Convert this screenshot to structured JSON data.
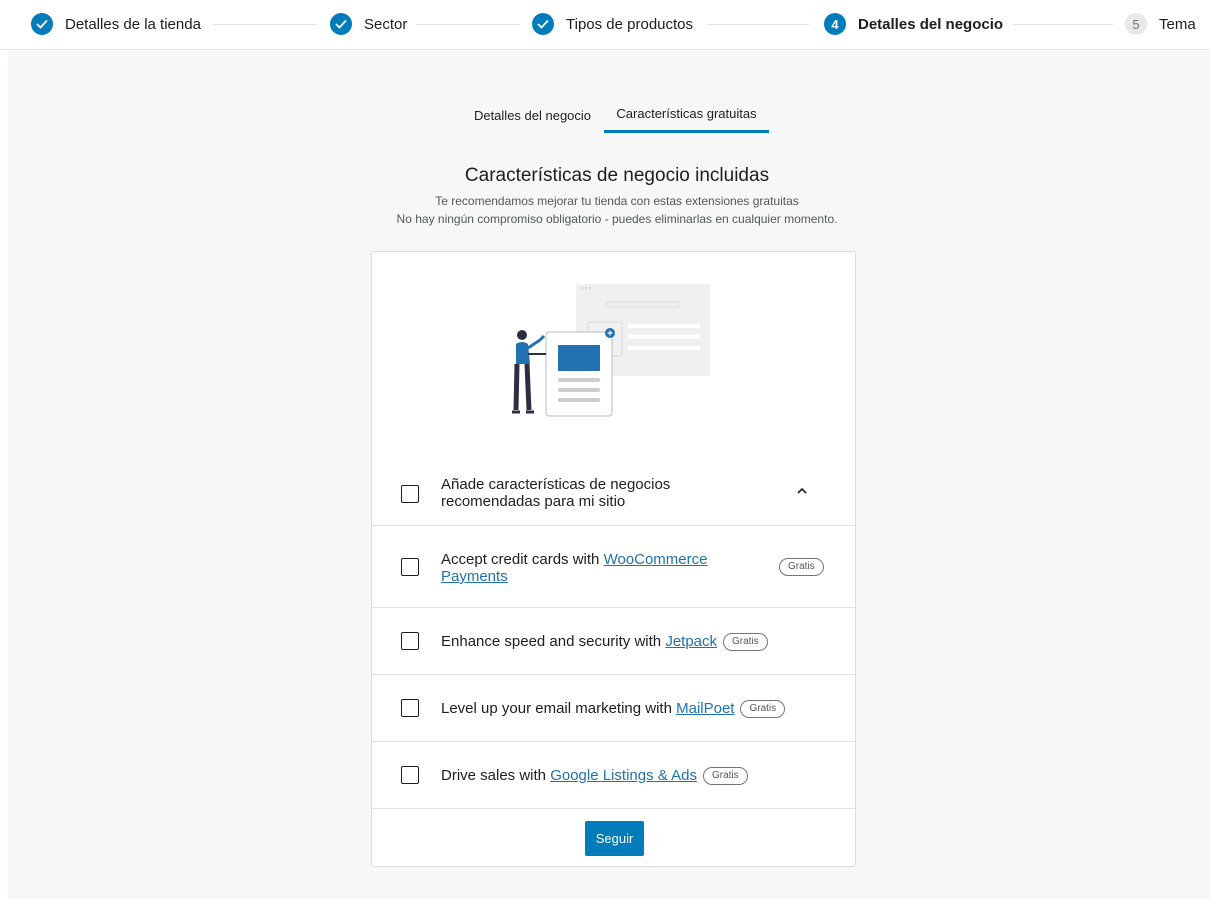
{
  "stepper": {
    "steps": [
      {
        "label": "Detalles de la tienda",
        "status": "done"
      },
      {
        "label": "Sector",
        "status": "done"
      },
      {
        "label": "Tipos de productos",
        "status": "done"
      },
      {
        "label": "Detalles del negocio",
        "status": "active",
        "number": "4"
      },
      {
        "label": "Tema",
        "status": "pending",
        "number": "5"
      }
    ]
  },
  "tabs": [
    {
      "label": "Detalles del negocio",
      "active": false
    },
    {
      "label": "Características gratuitas",
      "active": true
    }
  ],
  "heading": "Características de negocio incluidas",
  "subtitle_1": "Te recomendamos mejorar tu tienda con estas extensiones gratuitas",
  "subtitle_2": "No hay ningún compromiso obligatorio - puedes eliminarlas en cualquier momento.",
  "card": {
    "master": {
      "line1": "Añade características de negocios",
      "line2": "recomendadas para mi sitio",
      "checked": false,
      "expanded": true
    },
    "items": [
      {
        "prefix": "Accept credit cards with ",
        "link": "WooCommerce Payments",
        "link_line1": "WooCommerce",
        "link_line2": "Payments",
        "badge": "Gratis",
        "checked": false
      },
      {
        "prefix": "Enhance speed and security with ",
        "link": "Jetpack",
        "badge": "Gratis",
        "checked": false
      },
      {
        "prefix": "Level up your email marketing with ",
        "link": "MailPoet",
        "badge": "Gratis",
        "checked": false
      },
      {
        "prefix": "Drive sales with ",
        "link": "Google Listings & Ads",
        "badge": "Gratis",
        "checked": false
      }
    ],
    "button_label": "Seguir"
  },
  "colors": {
    "accent": "#007cba",
    "link": "#2271b1",
    "background": "#f6f7f7"
  },
  "icons": {
    "done": "checkmark-icon",
    "expand": "chevron-up-icon"
  }
}
